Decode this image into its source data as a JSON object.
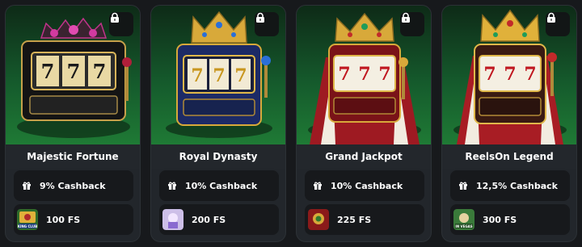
{
  "cards": [
    {
      "title": "Majestic Fortune",
      "cashback": "9% Cashback",
      "freespins": "100 FS",
      "thumb_label": "KING CLUB",
      "art_icon": "slot-machine-gem-crown-icon",
      "thumb_icon": "game-thumb-icon"
    },
    {
      "title": "Royal Dynasty",
      "cashback": "10% Cashback",
      "freespins": "200 FS",
      "art_icon": "slot-machine-crown-icon",
      "thumb_icon": "game-thumb-icon"
    },
    {
      "title": "Grand Jackpot",
      "cashback": "10% Cashback",
      "freespins": "225 FS",
      "art_icon": "slot-machine-crown-robe-icon",
      "thumb_icon": "game-thumb-icon"
    },
    {
      "title": "ReelsOn Legend",
      "cashback": "12,5% Cashback",
      "freespins": "300 FS",
      "thumb_label": "IN VEGAS",
      "art_icon": "slot-machine-crown-robe-icon",
      "thumb_icon": "game-thumb-icon"
    }
  ],
  "colors": {
    "page_bg": "#17191c",
    "card_bg": "#22262b",
    "art_green": "#1f7a35",
    "row_bg": "#17191c",
    "gold": "#d8a93a",
    "red": "#b21f24"
  },
  "icons": {
    "lock": "lock-icon",
    "gift": "gift-icon"
  }
}
